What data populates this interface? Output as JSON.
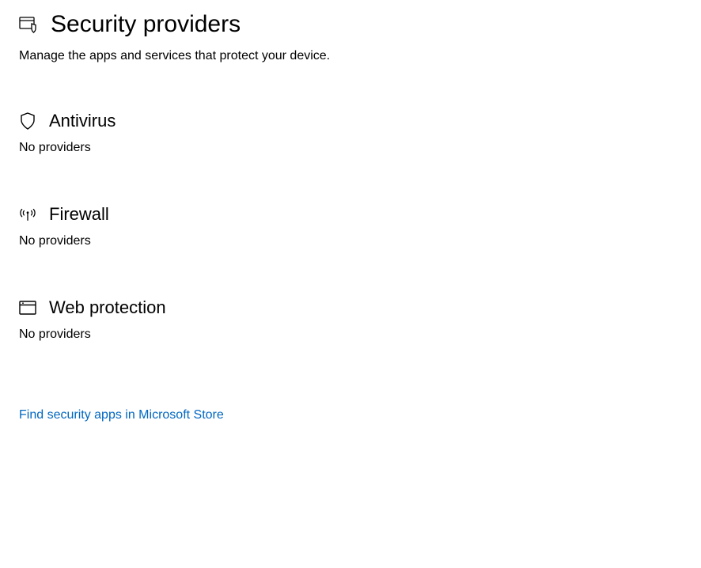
{
  "header": {
    "title": "Security providers",
    "subtitle": "Manage the apps and services that protect your device."
  },
  "sections": {
    "antivirus": {
      "title": "Antivirus",
      "status": "No providers"
    },
    "firewall": {
      "title": "Firewall",
      "status": "No providers"
    },
    "webprotection": {
      "title": "Web protection",
      "status": "No providers"
    }
  },
  "link": {
    "label": "Find security apps in Microsoft Store"
  }
}
